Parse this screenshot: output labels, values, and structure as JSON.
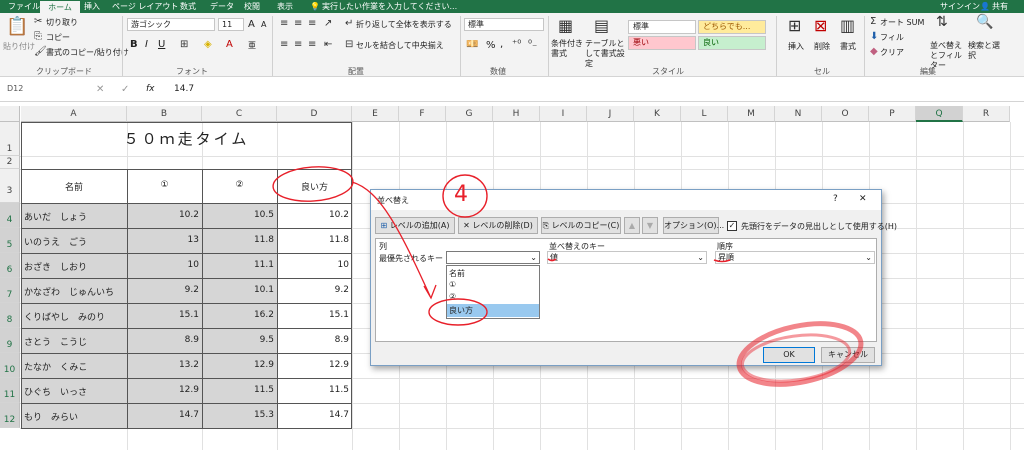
{
  "tabs": [
    "ファイル",
    "ホーム",
    "挿入",
    "ページ レイアウト",
    "数式",
    "データ",
    "校閲",
    "表示"
  ],
  "tell_me": "実行したい作業を入力してください...",
  "signin": "サインイン",
  "share": "共有",
  "ribbon": {
    "clipboard": {
      "paste": "貼り付け",
      "cut": "切り取り",
      "copy": "コピー",
      "format_painter": "書式のコピー/貼り付け",
      "label": "クリップボード"
    },
    "font": {
      "name": "游ゴシック",
      "size": "11",
      "grow": "A",
      "shrink": "A",
      "bold": "B",
      "italic": "I",
      "underline": "U",
      "phonetic": "亜",
      "label": "フォント"
    },
    "alignment": {
      "wrap": "折り返して全体を表示する",
      "merge": "セルを結合して中央揃え",
      "label": "配置"
    },
    "number": {
      "format": "標準",
      "percent": "%",
      "comma": ",",
      "label": "数値"
    },
    "styles": {
      "conditional": "条件付き書式",
      "table": "テーブルとして書式設定",
      "normal": "標準",
      "neutral": "どちらでも...",
      "bad": "悪い",
      "good": "良い",
      "label": "スタイル"
    },
    "cells": {
      "insert": "挿入",
      "delete": "削除",
      "format": "書式",
      "label": "セル"
    },
    "editing": {
      "autosum": "オート SUM",
      "fill": "フィル",
      "clear": "クリア",
      "sort": "並べ替えとフィルター",
      "find": "検索と選択",
      "label": "編集"
    }
  },
  "formula_bar": {
    "name_box": "D12",
    "fx": "fx",
    "value": "14.7"
  },
  "columns": [
    "A",
    "B",
    "C",
    "D",
    "E",
    "F",
    "G",
    "H",
    "I",
    "J",
    "K",
    "L",
    "M",
    "N",
    "O",
    "P",
    "Q",
    "R"
  ],
  "rows": [
    "1",
    "2",
    "3",
    "4",
    "5",
    "6",
    "7",
    "8",
    "9",
    "10",
    "11",
    "12"
  ],
  "sheet": {
    "title": "５０ｍ走タイム",
    "headers": [
      "名前",
      "①",
      "②",
      "良い方"
    ],
    "data": [
      {
        "name": "あいだ　しょう",
        "c1": "10.2",
        "c2": "10.5",
        "best": "10.2"
      },
      {
        "name": "いのうえ　ごう",
        "c1": "13",
        "c2": "11.8",
        "best": "11.8"
      },
      {
        "name": "おざき　しおり",
        "c1": "10",
        "c2": "11.1",
        "best": "10"
      },
      {
        "name": "かなざわ　じゅんいち",
        "c1": "9.2",
        "c2": "10.1",
        "best": "9.2"
      },
      {
        "name": "くりばやし　みのり",
        "c1": "15.1",
        "c2": "16.2",
        "best": "15.1"
      },
      {
        "name": "さとう　こうじ",
        "c1": "8.9",
        "c2": "9.5",
        "best": "8.9"
      },
      {
        "name": "たなか　くみこ",
        "c1": "13.2",
        "c2": "12.9",
        "best": "12.9"
      },
      {
        "name": "ひぐち　いっさ",
        "c1": "12.9",
        "c2": "11.5",
        "best": "11.5"
      },
      {
        "name": "もり　みらい",
        "c1": "14.7",
        "c2": "15.3",
        "best": "14.7"
      }
    ]
  },
  "annotation": {
    "number": "4"
  },
  "dialog": {
    "title": "並べ替え",
    "help": "?",
    "close": "✕",
    "add_level": "レベルの追加(A)",
    "delete_level": "レベルの削除(D)",
    "copy_level": "レベルのコピー(C)",
    "up": "▲",
    "down": "▼",
    "options": "オプション(O)...",
    "header_check_label": "先頭行をデータの見出しとして使用する(H)",
    "col_header": "列",
    "key_header": "並べ替えのキー",
    "order_header": "順序",
    "priority_label": "最優先されるキー",
    "key_value": "値",
    "order_value": "昇順",
    "dropdown_options": [
      "名前",
      "①",
      "②",
      "良い方"
    ],
    "ok": "OK",
    "cancel": "キャンセル"
  }
}
